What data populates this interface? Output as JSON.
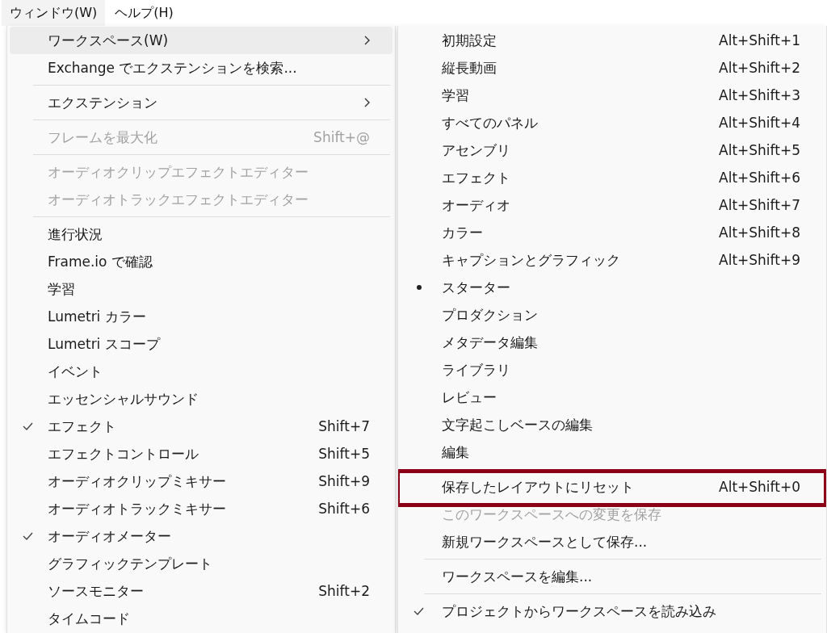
{
  "menu_bar": [
    {
      "label": "ウィンドウ(W)",
      "selected": true
    },
    {
      "label": "ヘルプ(H)",
      "selected": false
    }
  ],
  "window_menu": {
    "items": [
      {
        "kind": "item",
        "label": "ワークスペース(W)",
        "submenu": true,
        "selected": true,
        "checked": false,
        "disabled": false
      },
      {
        "kind": "item",
        "label": "Exchange でエクステンションを検索...",
        "submenu": false,
        "selected": false,
        "checked": false,
        "disabled": false
      },
      {
        "kind": "separator"
      },
      {
        "kind": "item",
        "label": "エクステンション",
        "submenu": true,
        "selected": false,
        "checked": false,
        "disabled": false
      },
      {
        "kind": "separator"
      },
      {
        "kind": "item",
        "label": "フレームを最大化",
        "shortcut": "Shift+@",
        "submenu": false,
        "selected": false,
        "checked": false,
        "disabled": true
      },
      {
        "kind": "separator"
      },
      {
        "kind": "item",
        "label": "オーディオクリップエフェクトエディター",
        "submenu": false,
        "selected": false,
        "checked": false,
        "disabled": true
      },
      {
        "kind": "item",
        "label": "オーディオトラックエフェクトエディター",
        "submenu": false,
        "selected": false,
        "checked": false,
        "disabled": true
      },
      {
        "kind": "separator"
      },
      {
        "kind": "item",
        "label": "進行状況",
        "submenu": false,
        "selected": false,
        "checked": false,
        "disabled": false
      },
      {
        "kind": "item",
        "label": "Frame.io で確認",
        "submenu": false,
        "selected": false,
        "checked": false,
        "disabled": false
      },
      {
        "kind": "item",
        "label": "学習",
        "submenu": false,
        "selected": false,
        "checked": false,
        "disabled": false
      },
      {
        "kind": "item",
        "label": "Lumetri カラー",
        "submenu": false,
        "selected": false,
        "checked": false,
        "disabled": false
      },
      {
        "kind": "item",
        "label": "Lumetri スコープ",
        "submenu": false,
        "selected": false,
        "checked": false,
        "disabled": false
      },
      {
        "kind": "item",
        "label": "イベント",
        "submenu": false,
        "selected": false,
        "checked": false,
        "disabled": false
      },
      {
        "kind": "item",
        "label": "エッセンシャルサウンド",
        "submenu": false,
        "selected": false,
        "checked": false,
        "disabled": false
      },
      {
        "kind": "item",
        "label": "エフェクト",
        "shortcut": "Shift+7",
        "submenu": false,
        "selected": false,
        "checked": true,
        "disabled": false
      },
      {
        "kind": "item",
        "label": "エフェクトコントロール",
        "shortcut": "Shift+5",
        "submenu": false,
        "selected": false,
        "checked": false,
        "disabled": false
      },
      {
        "kind": "item",
        "label": "オーディオクリップミキサー",
        "shortcut": "Shift+9",
        "submenu": false,
        "selected": false,
        "checked": false,
        "disabled": false
      },
      {
        "kind": "item",
        "label": "オーディオトラックミキサー",
        "shortcut": "Shift+6",
        "submenu": false,
        "selected": false,
        "checked": false,
        "disabled": false
      },
      {
        "kind": "item",
        "label": "オーディオメーター",
        "submenu": false,
        "selected": false,
        "checked": true,
        "disabled": false
      },
      {
        "kind": "item",
        "label": "グラフィックテンプレート",
        "submenu": false,
        "selected": false,
        "checked": false,
        "disabled": false
      },
      {
        "kind": "item",
        "label": "ソースモニター",
        "shortcut": "Shift+2",
        "submenu": false,
        "selected": false,
        "checked": false,
        "disabled": false
      },
      {
        "kind": "item",
        "label": "タイムコード",
        "submenu": false,
        "selected": false,
        "checked": false,
        "disabled": false
      }
    ]
  },
  "workspace_menu": {
    "items": [
      {
        "kind": "item",
        "label": "初期設定",
        "shortcut": "Alt+Shift+1",
        "current": false,
        "checked": false,
        "disabled": false,
        "highlighted": false
      },
      {
        "kind": "item",
        "label": "縦長動画",
        "shortcut": "Alt+Shift+2",
        "current": false,
        "checked": false,
        "disabled": false,
        "highlighted": false
      },
      {
        "kind": "item",
        "label": "学習",
        "shortcut": "Alt+Shift+3",
        "current": false,
        "checked": false,
        "disabled": false,
        "highlighted": false
      },
      {
        "kind": "item",
        "label": "すべてのパネル",
        "shortcut": "Alt+Shift+4",
        "current": false,
        "checked": false,
        "disabled": false,
        "highlighted": false
      },
      {
        "kind": "item",
        "label": "アセンブリ",
        "shortcut": "Alt+Shift+5",
        "current": false,
        "checked": false,
        "disabled": false,
        "highlighted": false
      },
      {
        "kind": "item",
        "label": "エフェクト",
        "shortcut": "Alt+Shift+6",
        "current": false,
        "checked": false,
        "disabled": false,
        "highlighted": false
      },
      {
        "kind": "item",
        "label": "オーディオ",
        "shortcut": "Alt+Shift+7",
        "current": false,
        "checked": false,
        "disabled": false,
        "highlighted": false
      },
      {
        "kind": "item",
        "label": "カラー",
        "shortcut": "Alt+Shift+8",
        "current": false,
        "checked": false,
        "disabled": false,
        "highlighted": false
      },
      {
        "kind": "item",
        "label": "キャプションとグラフィック",
        "shortcut": "Alt+Shift+9",
        "current": false,
        "checked": false,
        "disabled": false,
        "highlighted": false
      },
      {
        "kind": "item",
        "label": "スターター",
        "current": true,
        "checked": false,
        "disabled": false,
        "highlighted": false
      },
      {
        "kind": "item",
        "label": "プロダクション",
        "current": false,
        "checked": false,
        "disabled": false,
        "highlighted": false
      },
      {
        "kind": "item",
        "label": "メタデータ編集",
        "current": false,
        "checked": false,
        "disabled": false,
        "highlighted": false
      },
      {
        "kind": "item",
        "label": "ライブラリ",
        "current": false,
        "checked": false,
        "disabled": false,
        "highlighted": false
      },
      {
        "kind": "item",
        "label": "レビュー",
        "current": false,
        "checked": false,
        "disabled": false,
        "highlighted": false
      },
      {
        "kind": "item",
        "label": "文字起こしベースの編集",
        "current": false,
        "checked": false,
        "disabled": false,
        "highlighted": false
      },
      {
        "kind": "item",
        "label": "編集",
        "current": false,
        "checked": false,
        "disabled": false,
        "highlighted": false
      },
      {
        "kind": "separator"
      },
      {
        "kind": "item",
        "label": "保存したレイアウトにリセット",
        "shortcut": "Alt+Shift+0",
        "current": false,
        "checked": false,
        "disabled": false,
        "highlighted": true
      },
      {
        "kind": "item",
        "label": "このワークスペースへの変更を保存",
        "current": false,
        "checked": false,
        "disabled": true,
        "highlighted": false
      },
      {
        "kind": "item",
        "label": "新規ワークスペースとして保存...",
        "current": false,
        "checked": false,
        "disabled": false,
        "highlighted": false
      },
      {
        "kind": "separator"
      },
      {
        "kind": "item",
        "label": "ワークスペースを編集...",
        "current": false,
        "checked": false,
        "disabled": false,
        "highlighted": false
      },
      {
        "kind": "separator"
      },
      {
        "kind": "item",
        "label": "プロジェクトからワークスペースを読み込み",
        "current": false,
        "checked": true,
        "disabled": false,
        "highlighted": false
      }
    ]
  }
}
